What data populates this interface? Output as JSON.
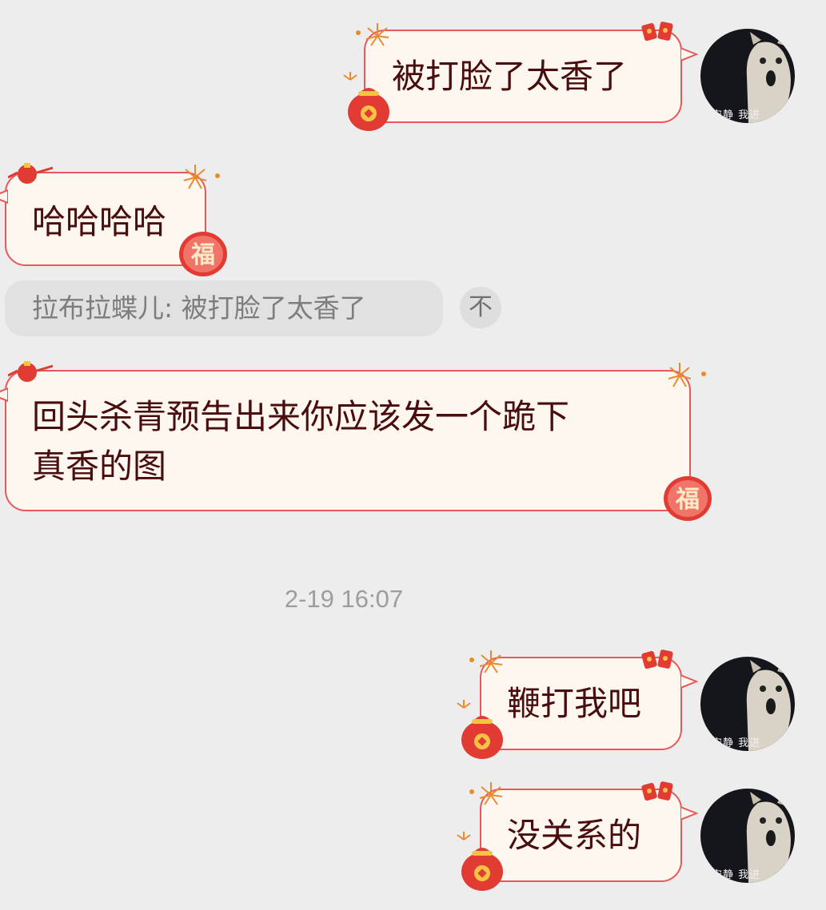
{
  "messages": [
    {
      "side": "right",
      "text": "被打脸了太香了"
    },
    {
      "side": "left",
      "text": "哈哈哈哈"
    },
    {
      "side": "left",
      "text_line1": "回头杀青预告出来你应该发一个跪下",
      "text_line2": "真香的图"
    },
    {
      "side": "right",
      "text": "鞭打我吧"
    },
    {
      "side": "right",
      "text": "没关系的"
    }
  ],
  "quote": {
    "text": "拉布拉蝶儿: 被打脸了太香了",
    "pin_icon": "不"
  },
  "timestamp": "2-19 16:07",
  "avatar": {
    "caption": "安静 我进"
  },
  "decor": {
    "fu": "福"
  },
  "colors": {
    "background": "#ededed",
    "bubble_border": "#e9575a",
    "bubble_fill": "#fdf7f0",
    "text": "#4a0d0d"
  }
}
